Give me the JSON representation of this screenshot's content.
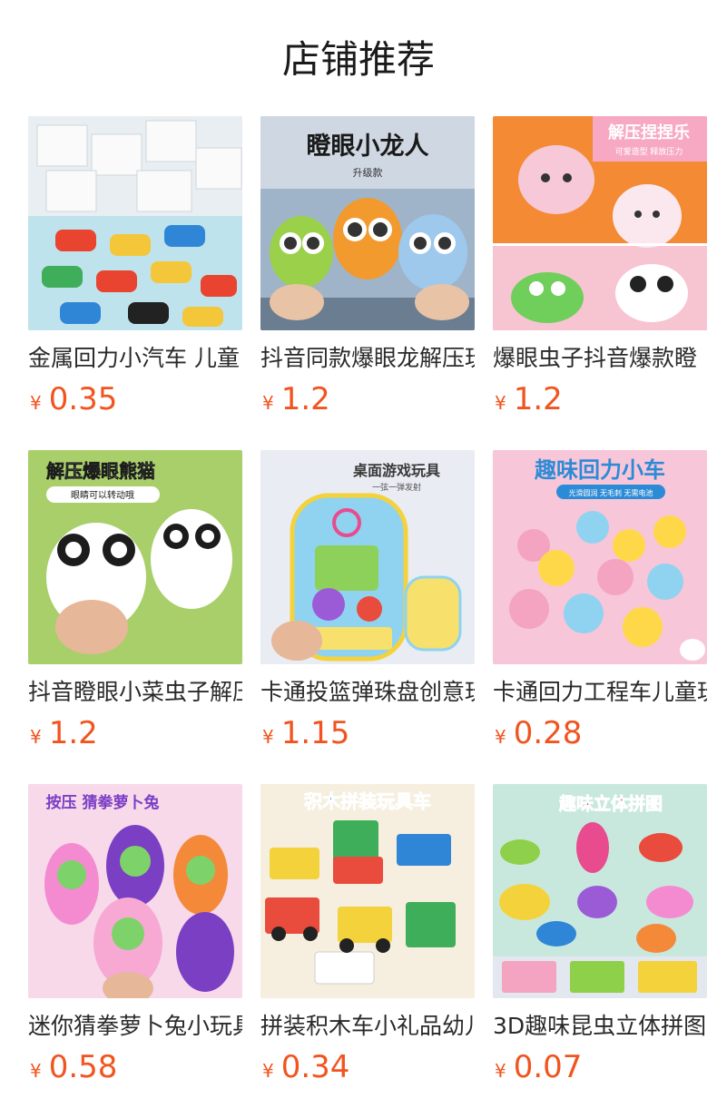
{
  "section": {
    "title": "店铺推荐"
  },
  "products": [
    {
      "name": "金属回力小汽车 儿童",
      "currency": "¥",
      "price": "0.35",
      "image_label": "",
      "image_sublabel": "",
      "bg": "#bfe3ec",
      "accent": "#e8442f"
    },
    {
      "name": "抖音同款爆眼龙解压玩具",
      "currency": "¥",
      "price": "1.2",
      "image_label": "瞪眼小龙人",
      "image_sublabel": "升级款",
      "bg": "#9fb4c9",
      "accent": "#f4e02a"
    },
    {
      "name": "爆眼虫子抖音爆款瞪",
      "currency": "¥",
      "price": "1.2",
      "image_label": "解压捏捏乐",
      "image_sublabel": "可爱造型 释放压力",
      "bg": "#f48a33",
      "accent": "#ffffff"
    },
    {
      "name": "抖音瞪眼小菜虫子解压玩具",
      "currency": "¥",
      "price": "1.2",
      "image_label": "解压爆眼熊猫",
      "image_sublabel": "眼睛可以转动哦",
      "bg": "#a9cf6b",
      "accent": "#1c1c1c"
    },
    {
      "name": "卡通投篮弹珠盘创意玩具",
      "currency": "¥",
      "price": "1.15",
      "image_label": "桌面游戏玩具",
      "image_sublabel": "一弦一弹发射",
      "bg": "#e9ecf2",
      "accent": "#f4d23c"
    },
    {
      "name": "卡通回力工程车儿童玩具",
      "currency": "¥",
      "price": "0.28",
      "image_label": "趣味回力小车",
      "image_sublabel": "光滑圆润 无毛刺 无需电池",
      "bg": "#f7c6d9",
      "accent": "#2c8bd6"
    },
    {
      "name": "迷你猜拳萝卜兔小玩具",
      "currency": "¥",
      "price": "0.58",
      "image_label": "按压 猜拳萝卜兔",
      "image_sublabel": "",
      "bg": "#f7d9ea",
      "accent": "#7b3fc4"
    },
    {
      "name": "拼装积木车小礼品幼儿园",
      "currency": "¥",
      "price": "0.34",
      "image_label": "积木拼装玩具车",
      "image_sublabel": "",
      "bg": "#f6efdf",
      "accent": "#2f9fd8"
    },
    {
      "name": "3D趣味昆虫立体拼图",
      "currency": "¥",
      "price": "0.07",
      "image_label": "趣味立体拼图",
      "image_sublabel": "",
      "bg": "#cfe9d6",
      "accent": "#e94b3c"
    }
  ]
}
